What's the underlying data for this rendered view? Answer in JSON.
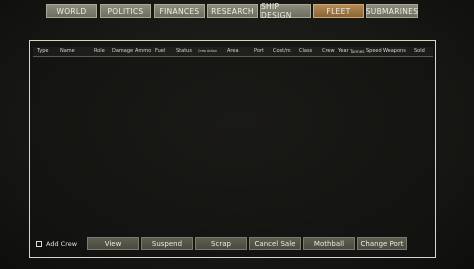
{
  "nav": {
    "tabs": [
      {
        "label": "WORLD"
      },
      {
        "label": "POLITICS"
      },
      {
        "label": "FINANCES"
      },
      {
        "label": "RESEARCH"
      },
      {
        "label": "SHIP DESIGN"
      },
      {
        "label": "FLEET",
        "active": true
      },
      {
        "label": "SUBMARINES"
      }
    ]
  },
  "table": {
    "columns": [
      "Type",
      "Name",
      "Role",
      "Damage",
      "Ammo",
      "Fuel",
      "Status",
      "Crew Action",
      "Area",
      "Port",
      "Cost/m",
      "Class",
      "Crew",
      "Year",
      "Tonnes",
      "Speed",
      "Weapons",
      "Sold"
    ],
    "rows": []
  },
  "controls": {
    "add_crew_label": "Add Crew",
    "add_crew_checked": false,
    "buttons": [
      "View",
      "Suspend",
      "Scrap",
      "Cancel Sale",
      "Mothball",
      "Change Port"
    ]
  },
  "colors": {
    "tab_bg": "#7e7d6d",
    "tab_active_bg": "#a07a46",
    "panel_border": "#d9d6c8",
    "button_bg": "#55554a"
  }
}
